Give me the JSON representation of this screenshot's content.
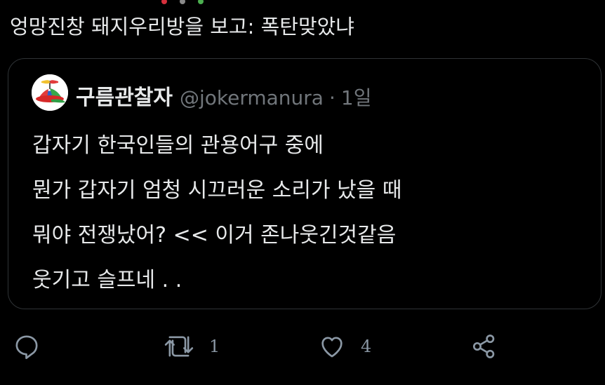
{
  "tweet": {
    "text": "엉망진창 돼지우리방을 보고: 폭탄맞았냐"
  },
  "quoted": {
    "author_name": "구름관찰자",
    "author_handle": "@jokermanura",
    "separator": "·",
    "time": "1일",
    "lines": [
      "갑자기 한국인들의 관용어구 중에",
      "뭔가 갑자기 엄청 시끄러운 소리가 났을 때",
      "뭐야 전쟁났어? << 이거 존나웃긴것같음",
      "웃기고 슬프네 . ."
    ]
  },
  "actions": {
    "reply_icon": "reply-icon",
    "retweet_icon": "retweet-icon",
    "retweet_count": "1",
    "like_icon": "heart-icon",
    "like_count": "4",
    "share_icon": "share-icon"
  },
  "colors": {
    "background": "#000000",
    "text": "#e7e9ea",
    "muted": "#71767b",
    "card_border": "#2f3336"
  }
}
